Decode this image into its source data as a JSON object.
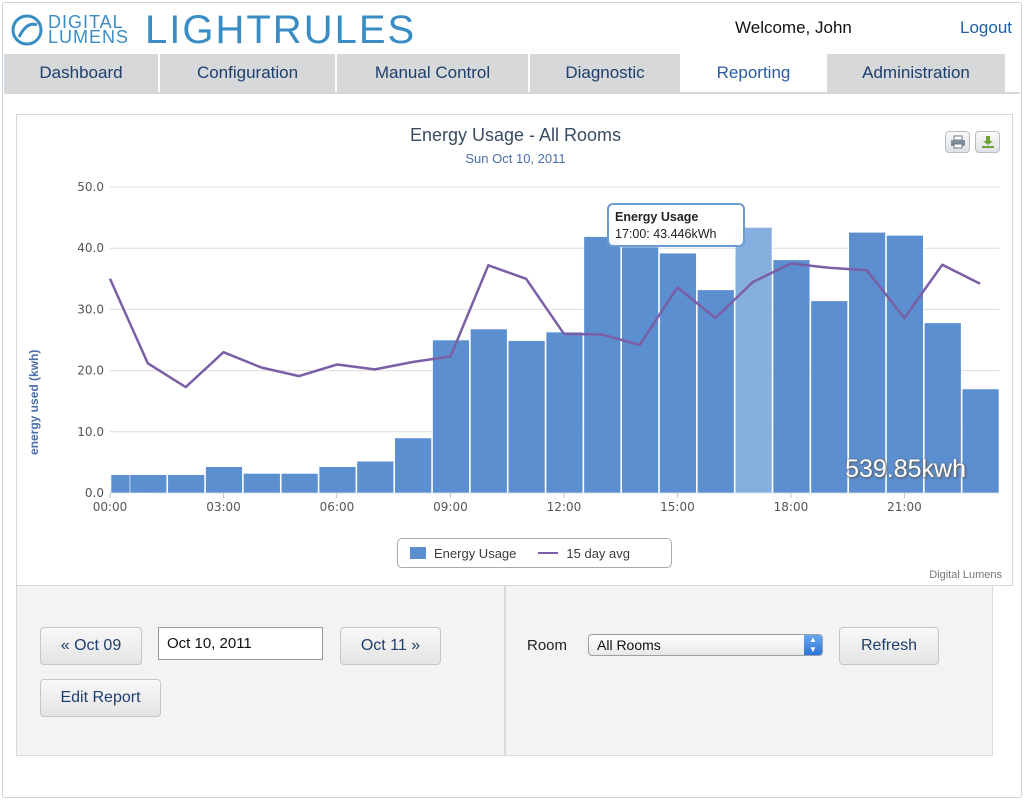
{
  "header": {
    "logo_small_line1": "DIGITAL",
    "logo_small_line2": "LUMENS",
    "logo_big": "LIGHTRULES",
    "welcome": "Welcome, John",
    "logout": "Logout"
  },
  "nav": {
    "tabs": [
      {
        "label": "Dashboard",
        "active": false
      },
      {
        "label": "Configuration",
        "active": false
      },
      {
        "label": "Manual Control",
        "active": false
      },
      {
        "label": "Diagnostic",
        "active": false
      },
      {
        "label": "Reporting",
        "active": true
      },
      {
        "label": "Administration",
        "active": false
      }
    ]
  },
  "toolbar": {
    "print_icon": "printer-icon",
    "export_icon": "download-icon"
  },
  "tooltip": {
    "title": "Energy Usage",
    "value": "17:00: 43.446kWh"
  },
  "total": "539.85kwh",
  "credits": "Digital Lumens",
  "chart_data": {
    "type": "bar",
    "title": "Energy Usage - All Rooms",
    "subtitle": "Sun Oct 10, 2011",
    "ylabel": "energy used (kwh)",
    "xlabel": "",
    "ylim": [
      0,
      50
    ],
    "yticks": [
      "0.0",
      "10.0",
      "20.0",
      "30.0",
      "40.0",
      "50.0"
    ],
    "xticks": [
      "00:00",
      "03:00",
      "06:00",
      "09:00",
      "12:00",
      "15:00",
      "18:00",
      "21:00"
    ],
    "hours": [
      0,
      1,
      2,
      3,
      4,
      5,
      6,
      7,
      8,
      9,
      10,
      11,
      12,
      13,
      14,
      15,
      16,
      17,
      18,
      19,
      20,
      21,
      22,
      23
    ],
    "series": [
      {
        "name": "Energy Usage",
        "kind": "bar",
        "color": "#5b8fcf",
        "highlight_color": "#86afe0",
        "highlight_index": 17,
        "values": [
          3.0,
          3.0,
          3.0,
          4.3,
          3.2,
          3.2,
          4.3,
          5.2,
          9.0,
          25.0,
          26.8,
          24.9,
          26.3,
          41.9,
          40.2,
          39.2,
          33.2,
          43.4,
          38.1,
          31.4,
          42.6,
          42.1,
          27.8,
          17.0
        ]
      },
      {
        "name": "15 day avg",
        "kind": "line",
        "color": "#7b5fa6",
        "values": [
          35.0,
          21.2,
          17.3,
          23.0,
          20.5,
          19.1,
          21.0,
          20.2,
          21.4,
          22.3,
          37.2,
          35.0,
          26.0,
          25.9,
          24.2,
          33.6,
          28.6,
          34.5,
          37.5,
          36.8,
          36.4,
          28.6,
          37.3,
          34.2
        ]
      }
    ],
    "legend": "bottom-center",
    "grid": true
  },
  "controls": {
    "prev_label": "« Oct 09",
    "date_value": "Oct 10, 2011",
    "next_label": "Oct 11 »",
    "edit_label": "Edit Report",
    "room_label": "Room",
    "room_value": "All Rooms",
    "refresh_label": "Refresh"
  }
}
